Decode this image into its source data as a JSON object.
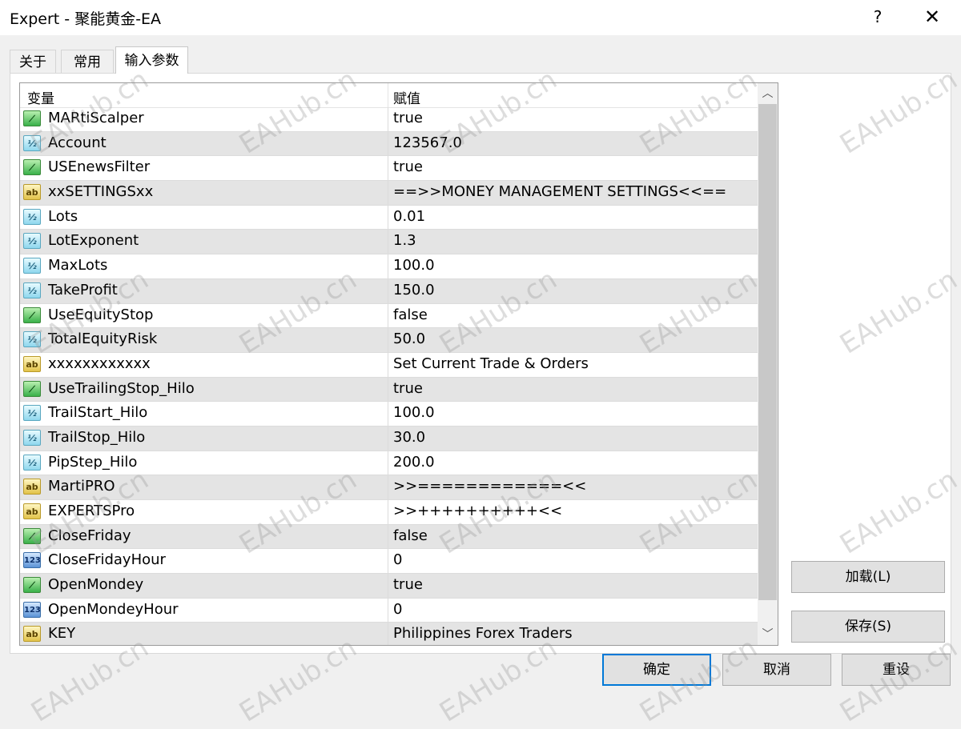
{
  "window": {
    "title": "Expert - 聚能黄金-EA",
    "help": "?",
    "close": "✕"
  },
  "tabs": [
    {
      "label": "关于"
    },
    {
      "label": "常用"
    },
    {
      "label": "输入参数"
    }
  ],
  "grid": {
    "headers": {
      "variable": "变量",
      "value": "赋值"
    },
    "rows": [
      {
        "type": "bool",
        "icon": "bool-icon",
        "name": "MARtiScalper",
        "value": "true"
      },
      {
        "type": "double",
        "icon": "double-icon",
        "name": "Account",
        "value": "123567.0"
      },
      {
        "type": "bool",
        "icon": "bool-icon",
        "name": "USEnewsFilter",
        "value": "true"
      },
      {
        "type": "string",
        "icon": "string-icon",
        "name": "xxSETTINGSxx",
        "value": "==>>MONEY MANAGEMENT SETTINGS<<=="
      },
      {
        "type": "double",
        "icon": "double-icon",
        "name": "Lots",
        "value": "0.01"
      },
      {
        "type": "double",
        "icon": "double-icon",
        "name": "LotExponent",
        "value": "1.3"
      },
      {
        "type": "double",
        "icon": "double-icon",
        "name": "MaxLots",
        "value": "100.0"
      },
      {
        "type": "double",
        "icon": "double-icon",
        "name": "TakeProfit",
        "value": "150.0"
      },
      {
        "type": "bool",
        "icon": "bool-icon",
        "name": "UseEquityStop",
        "value": "false"
      },
      {
        "type": "double",
        "icon": "double-icon",
        "name": "TotalEquityRisk",
        "value": "50.0"
      },
      {
        "type": "string",
        "icon": "string-icon",
        "name": "xxxxxxxxxxxx",
        "value": "Set Current Trade & Orders"
      },
      {
        "type": "bool",
        "icon": "bool-icon",
        "name": "UseTrailingStop_Hilo",
        "value": "true"
      },
      {
        "type": "double",
        "icon": "double-icon",
        "name": "TrailStart_Hilo",
        "value": "100.0"
      },
      {
        "type": "double",
        "icon": "double-icon",
        "name": "TrailStop_Hilo",
        "value": "30.0"
      },
      {
        "type": "double",
        "icon": "double-icon",
        "name": "PipStep_Hilo",
        "value": "200.0"
      },
      {
        "type": "string",
        "icon": "string-icon",
        "name": "MartiPRO",
        "value": ">>============<<"
      },
      {
        "type": "string",
        "icon": "string-icon",
        "name": "EXPERTSPro",
        "value": ">>++++++++++<<"
      },
      {
        "type": "bool",
        "icon": "bool-icon",
        "name": "CloseFriday",
        "value": "false"
      },
      {
        "type": "int",
        "icon": "int-icon",
        "name": "CloseFridayHour",
        "value": "0"
      },
      {
        "type": "bool",
        "icon": "bool-icon",
        "name": "OpenMondey",
        "value": "true"
      },
      {
        "type": "int",
        "icon": "int-icon",
        "name": "OpenMondeyHour",
        "value": "0"
      },
      {
        "type": "string",
        "icon": "string-icon",
        "name": "KEY",
        "value": "Philippines Forex Traders"
      }
    ]
  },
  "icon_glyphs": {
    "bool": "⟋",
    "double": "½",
    "string": "ab",
    "int": "123"
  },
  "buttons": {
    "load": "加载(L)",
    "save": "保存(S)",
    "ok": "确定",
    "cancel": "取消",
    "reset": "重设"
  },
  "watermark": "EAHub.cn"
}
